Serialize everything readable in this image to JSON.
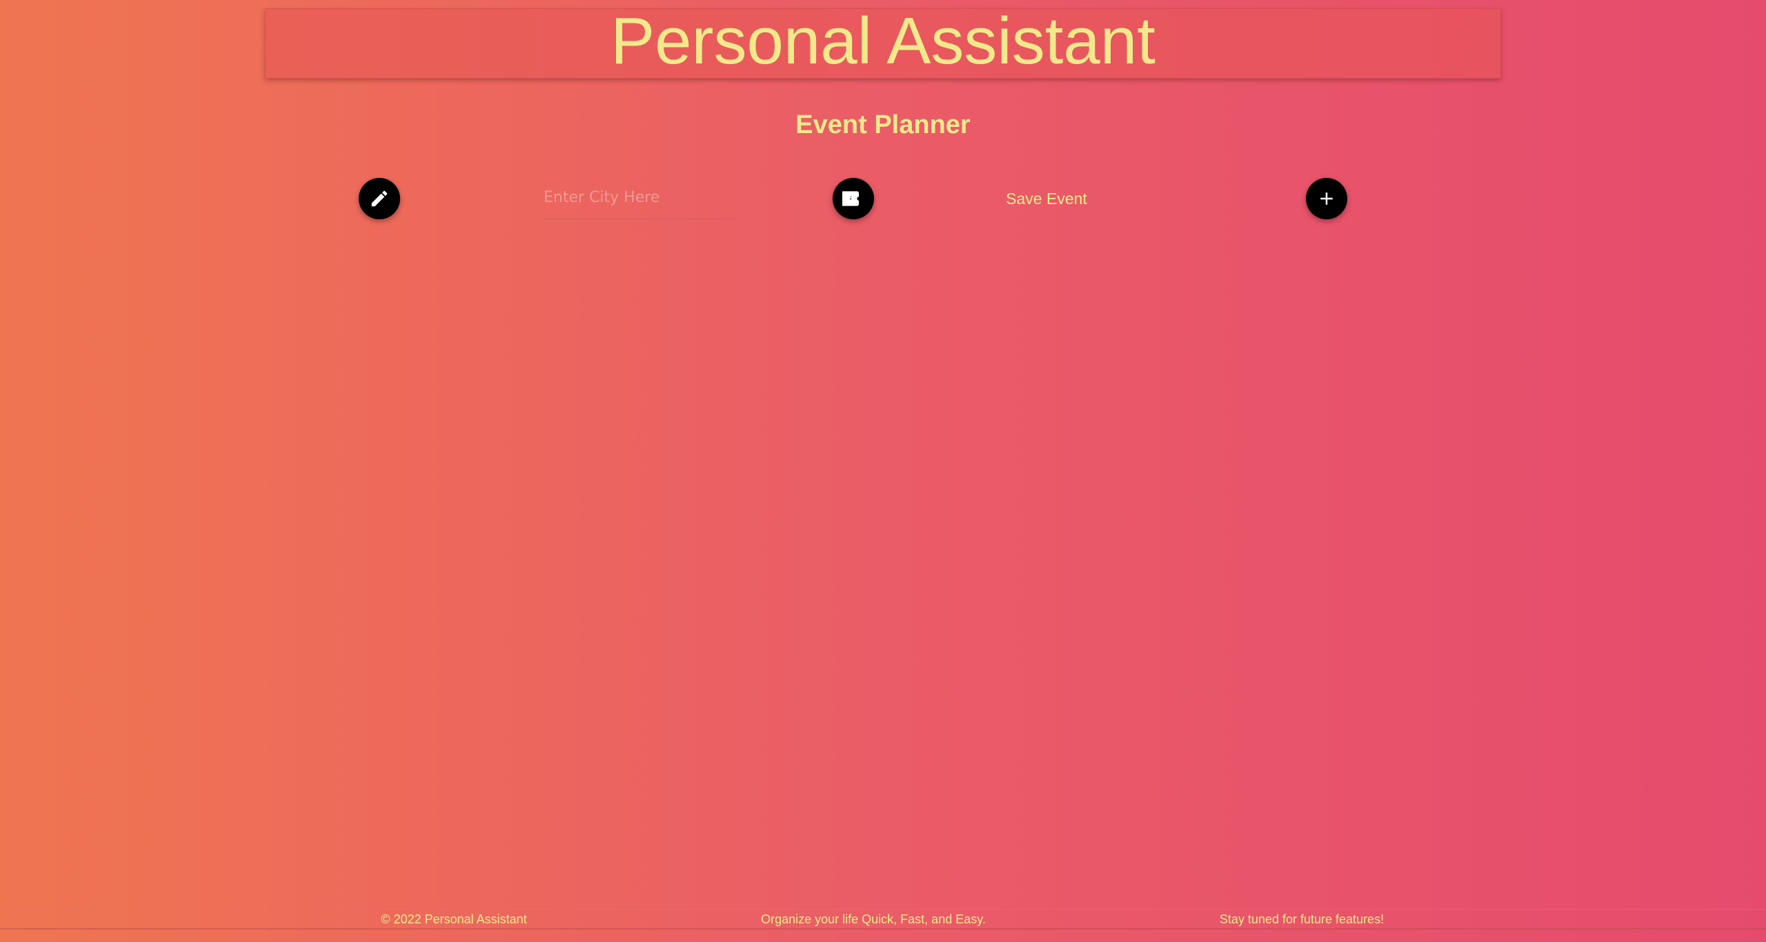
{
  "header": {
    "title": "Personal Assistant"
  },
  "planner": {
    "subtitle": "Event Planner",
    "city_input": {
      "placeholder": "Enter City Here",
      "value": ""
    },
    "save_label": "Save Event",
    "icons": {
      "edit": "pencil-icon",
      "ticket": "ticket-icon",
      "add": "plus-icon"
    }
  },
  "footer": {
    "copyright": "© 2022 Personal Assistant",
    "tagline": "Organize your life Quick, Fast, and Easy.",
    "notice": "Stay tuned for future features!"
  },
  "colors": {
    "gradient_start": "#ef7551",
    "gradient_end": "#e64b6d",
    "text": "#f2ea8a",
    "fab": "#000000"
  }
}
